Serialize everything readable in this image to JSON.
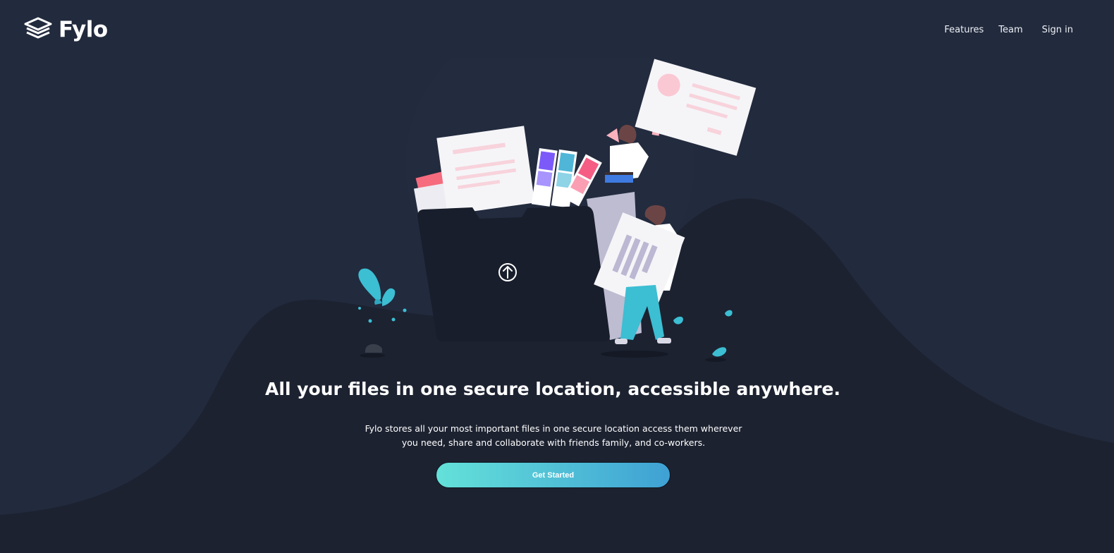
{
  "brand": {
    "name": "Fylo",
    "logo_icon": "layers-icon"
  },
  "nav": {
    "features": "Features",
    "team": "Team",
    "signin": "Sign in"
  },
  "hero": {
    "title": "All your files in one secure location, accessible anywhere.",
    "description": "Fylo stores all your most important files in one secure location access them wherever you need, share and collaborate with friends family, and co-workers.",
    "cta_label": "Get Started",
    "illustration_icon": "upload-arrow-icon"
  },
  "colors": {
    "background": "#1c2230",
    "header_background": "#232a3d",
    "accent_start": "#64e1d9",
    "accent_end": "#3fa1d4",
    "text": "#ffffff"
  }
}
